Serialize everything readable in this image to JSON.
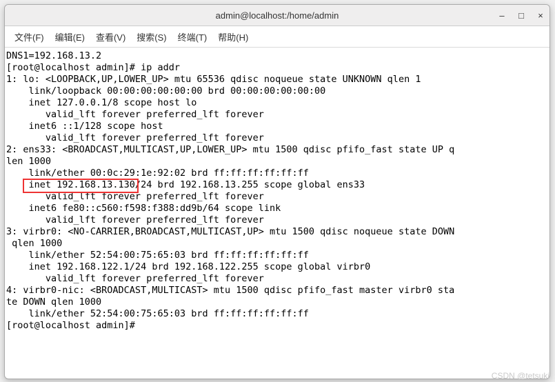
{
  "title": "admin@localhost:/home/admin",
  "menu": {
    "file": "文件(F)",
    "edit": "编辑(E)",
    "view": "查看(V)",
    "search": "搜索(S)",
    "terminal": "终端(T)",
    "help": "帮助(H)"
  },
  "winbtn": {
    "min": "–",
    "max": "□",
    "close": "×"
  },
  "lines": [
    "DNS1=192.168.13.2",
    "[root@localhost admin]# ip addr",
    "1: lo: <LOOPBACK,UP,LOWER_UP> mtu 65536 qdisc noqueue state UNKNOWN qlen 1",
    "    link/loopback 00:00:00:00:00:00 brd 00:00:00:00:00:00",
    "    inet 127.0.0.1/8 scope host lo",
    "       valid_lft forever preferred_lft forever",
    "    inet6 ::1/128 scope host",
    "       valid_lft forever preferred_lft forever",
    "2: ens33: <BROADCAST,MULTICAST,UP,LOWER_UP> mtu 1500 qdisc pfifo_fast state UP q",
    "len 1000",
    "    link/ether 00:0c:29:1e:92:02 brd ff:ff:ff:ff:ff:ff",
    "    inet 192.168.13.130/24 brd 192.168.13.255 scope global ens33",
    "       valid_lft forever preferred_lft forever",
    "    inet6 fe80::c560:f598:f388:dd9b/64 scope link",
    "       valid_lft forever preferred_lft forever",
    "3: virbr0: <NO-CARRIER,BROADCAST,MULTICAST,UP> mtu 1500 qdisc noqueue state DOWN",
    " qlen 1000",
    "    link/ether 52:54:00:75:65:03 brd ff:ff:ff:ff:ff:ff",
    "    inet 192.168.122.1/24 brd 192.168.122.255 scope global virbr0",
    "       valid_lft forever preferred_lft forever",
    "4: virbr0-nic: <BROADCAST,MULTICAST> mtu 1500 qdisc pfifo_fast master virbr0 sta",
    "te DOWN qlen 1000",
    "    link/ether 52:54:00:75:65:03 brd ff:ff:ff:ff:ff:ff",
    "[root@localhost admin]#"
  ],
  "highlight": {
    "top_line": 11,
    "left_ch": 3,
    "chars": 20
  },
  "watermark": "CSDN @tetsuki"
}
